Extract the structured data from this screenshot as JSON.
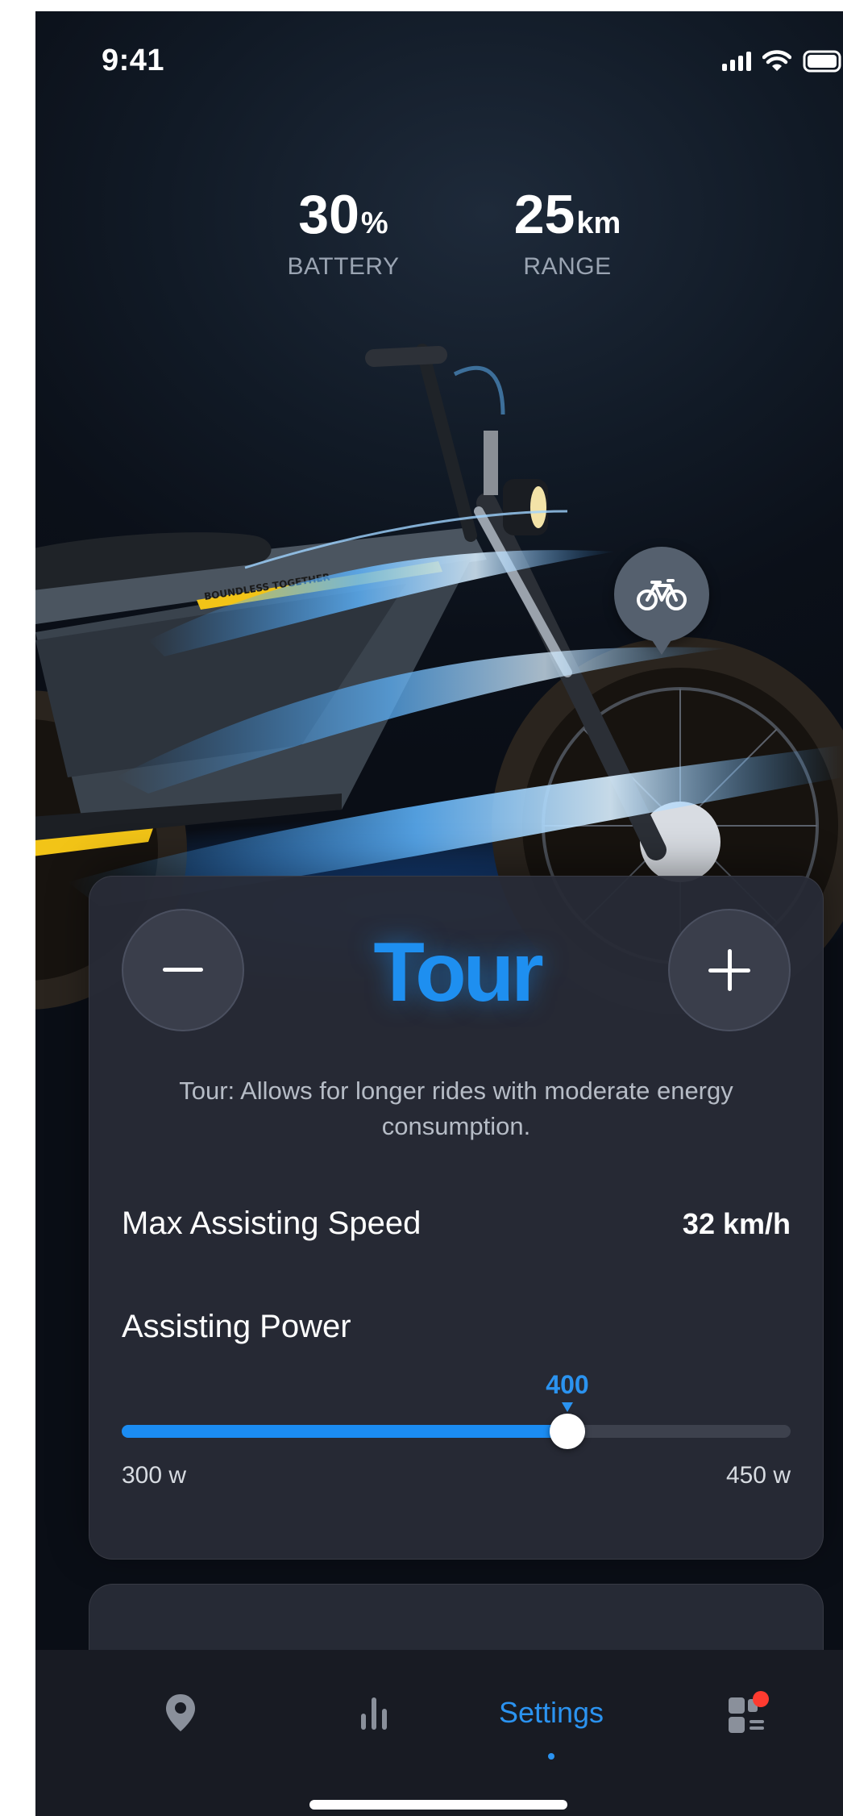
{
  "status_bar": {
    "time": "9:41"
  },
  "stats": {
    "battery": {
      "value": "30",
      "unit": "%",
      "label": "BATTERY"
    },
    "range": {
      "value": "25",
      "unit": "km",
      "label": "RANGE"
    }
  },
  "bike": {
    "decal_text": "BOUNDLESS TOGETHER",
    "pin_icon": "bicycle-icon"
  },
  "mode": {
    "name": "Tour",
    "decrease_icon": "minus-icon",
    "increase_icon": "plus-icon",
    "description": "Tour: Allows for longer rides with moderate energy consumption.",
    "max_speed_label": "Max Assisting Speed",
    "max_speed_value": "32 km/h",
    "power_label": "Assisting Power",
    "power_value": "400",
    "power_min_label": "300 w",
    "power_max_label": "450 w",
    "power_min": 300,
    "power_max": 450,
    "power_current": 400,
    "accent_color": "#1e8ff0"
  },
  "tabbar": {
    "items": [
      {
        "id": "map",
        "icon": "map-pin-icon"
      },
      {
        "id": "stats",
        "icon": "bar-chart-icon"
      },
      {
        "id": "settings",
        "label": "Settings",
        "active": true
      },
      {
        "id": "more",
        "icon": "dashboard-icon",
        "badge": true
      }
    ]
  },
  "colors": {
    "accent": "#1e8ff0",
    "background": "#0b1019",
    "card": "#282b36",
    "badge": "#ff3b30"
  }
}
